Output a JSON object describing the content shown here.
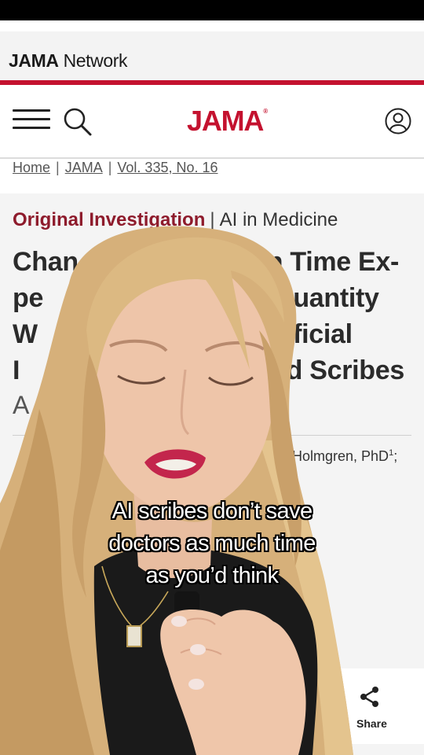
{
  "network_bar": {
    "brand_bold": "JAMA",
    "brand_rest": " Network"
  },
  "header": {
    "logo": "JAMA",
    "logo_mark": "®"
  },
  "breadcrumb": [
    {
      "label": "Home"
    },
    {
      "label": "JAMA"
    },
    {
      "label": "Vol. 335, No. 16"
    }
  ],
  "article": {
    "type": "Original Investigation",
    "category": "AI in Medicine",
    "title_lines": [
      "Chan",
      "ian Time Ex-",
      "pe",
      "t Quantity",
      "W",
      "rtificial",
      "I",
      "ed Scribes"
    ],
    "subtitle": "A",
    "authors_fragment": "ay Holmgren, PhD",
    "authors_sup": "1",
    "authors_suffix": ";"
  },
  "share": {
    "label": "Share",
    "icon": "share-icon"
  },
  "overlay_caption": [
    "AI scribes don’t save",
    "doctors as much time",
    "as you’d think"
  ],
  "colors": {
    "brand_red": "#c4122f",
    "kicker_red": "#8e1b2c",
    "hair": "#d9b57c",
    "skin": "#ecc3a8"
  }
}
